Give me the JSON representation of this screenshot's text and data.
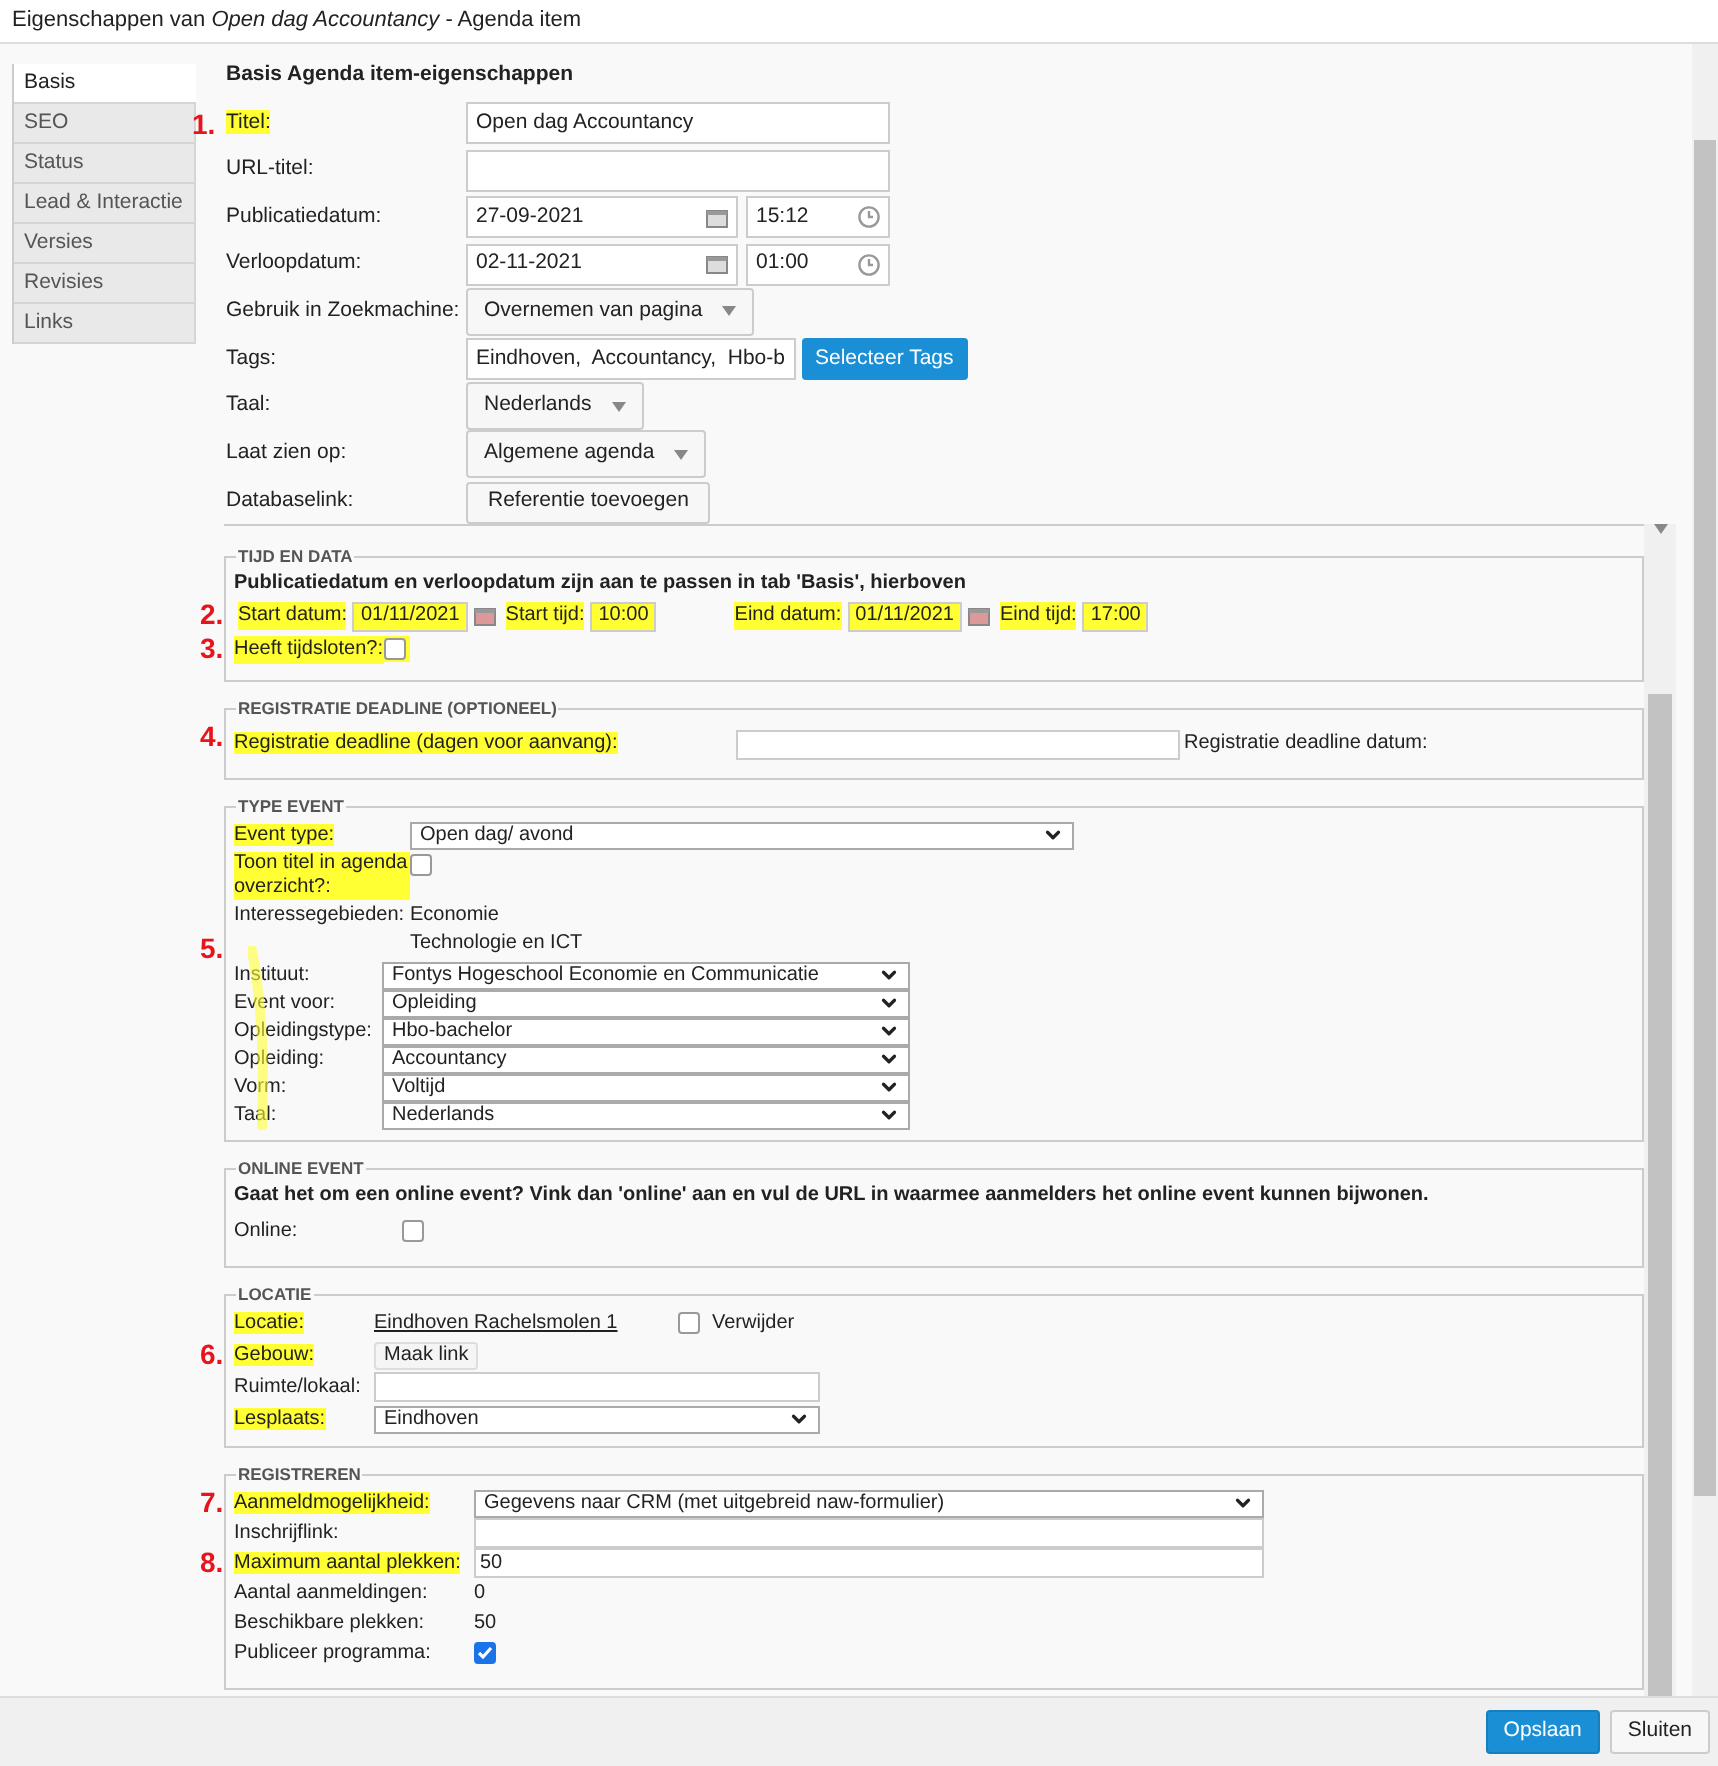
{
  "window": {
    "title": "Eigenschappen van *Open dag Accountancy* - Agenda item"
  },
  "tabs": [
    {
      "label": "Basis",
      "selected": true
    },
    {
      "label": "SEO",
      "selected": false
    },
    {
      "label": "Status",
      "selected": false
    },
    {
      "label": "Lead & Interactie",
      "selected": false
    },
    {
      "label": "Versies",
      "selected": false
    },
    {
      "label": "Revisies",
      "selected": false
    },
    {
      "label": "Links",
      "selected": false
    }
  ],
  "basis": {
    "heading": "Basis Agenda item-eigenschappen",
    "fields": [
      {
        "kind": "text",
        "label": "Titel:",
        "value": "Open dag Accountancy",
        "marker": "1.",
        "highlighted": true
      },
      {
        "kind": "text",
        "label": "URL-titel:",
        "highlighted": false
      },
      {
        "kind": "datetime",
        "label": "Publicatiedatum:",
        "date": "27-09-2021",
        "time": "15:12",
        "highlighted": false
      },
      {
        "kind": "datetime",
        "label": "Verloopdatum:",
        "date": "02-11-2021",
        "time": "01:00",
        "highlighted": false
      },
      {
        "kind": "select",
        "label": "Gebruik in Zoekmachine:",
        "value": "Overnemen van pagina",
        "highlighted": false
      },
      {
        "kind": "tags",
        "label": "Tags:",
        "value": "Eindhoven,  Accountancy,  Hbo-b",
        "button": "Selecteer Tags",
        "highlighted": false
      },
      {
        "kind": "select",
        "label": "Taal:",
        "value": "Nederlands",
        "highlighted": false
      },
      {
        "kind": "select",
        "label": "Laat zien op:",
        "value": "Algemene agenda",
        "highlighted": false
      },
      {
        "kind": "button",
        "label": "Databaselink:",
        "button": "Referentie toevoegen",
        "highlighted": false
      }
    ]
  },
  "sections": [
    {
      "legend": "TIJD EN DATA",
      "rows": [
        {
          "kind": "note",
          "text": "Publicatiedatum en verloopdatum zijn aan te passen in tab 'Basis', hierboven"
        },
        {
          "kind": "dates",
          "marker": "2.",
          "parts": [
            {
              "label": "Start datum:",
              "value": "01/11/2021",
              "calendar": true,
              "highlighted": true
            },
            {
              "label": "Start tijd:",
              "value": "10:00",
              "calendar": false,
              "highlighted": true
            },
            {
              "label": "Eind datum:",
              "value": "01/11/2021",
              "calendar": true,
              "highlighted": true
            },
            {
              "label": "Eind tijd:",
              "value": "17:00",
              "calendar": false,
              "highlighted": true
            }
          ]
        },
        {
          "kind": "checkbox-inline",
          "label": "Heeft tijdsloten?:",
          "checked": false,
          "marker": "3.",
          "highlighted": true
        }
      ]
    },
    {
      "legend": "REGISTRATIE DEADLINE (OPTIONEEL)",
      "rows": [
        {
          "kind": "deadline",
          "label": "Registratie deadline (dagen voor aanvang):",
          "after": "Registratie deadline datum:",
          "marker": "4.",
          "highlighted": true
        }
      ]
    },
    {
      "legend": "TYPE EVENT",
      "rows": [
        {
          "kind": "select",
          "label": "Event type:",
          "value": "Open dag/ avond",
          "highlighted": true
        },
        {
          "kind": "checkbox-wrap",
          "label": "Toon titel in agenda overzicht?:",
          "checked": false,
          "highlighted": true
        },
        {
          "kind": "values",
          "label": "Interessegebieden:",
          "values": [
            "Economie",
            "Technologie en ICT"
          ],
          "highlighted": false
        },
        {
          "kind": "select-group",
          "marker": "5.",
          "highlighted": true,
          "items": [
            {
              "label": "Instituut:",
              "value": "Fontys Hogeschool Economie en Communicatie"
            },
            {
              "label": "Event voor:",
              "value": "Opleiding"
            },
            {
              "label": "Opleidingstype:",
              "value": "Hbo-bachelor"
            },
            {
              "label": "Opleiding:",
              "value": "Accountancy"
            },
            {
              "label": "Vorm:",
              "value": "Voltijd"
            },
            {
              "label": "Taal:",
              "value": "Nederlands"
            }
          ]
        }
      ]
    },
    {
      "legend": "ONLINE EVENT",
      "rows": [
        {
          "kind": "note",
          "text": "Gaat het om een online event? Vink dan 'online' aan en vul de URL in waarmee aanmelders het online event kunnen bijwonen."
        },
        {
          "kind": "checkbox",
          "label": "Online:",
          "checked": false,
          "highlighted": false
        }
      ]
    },
    {
      "legend": "LOCATIE",
      "rows": [
        {
          "kind": "link",
          "label": "Locatie:",
          "value": "Eindhoven Rachelsmolen 1",
          "check_label": "Verwijder",
          "checked": false,
          "highlighted": true
        },
        {
          "kind": "button",
          "label": "Gebouw:",
          "value": "Maak link",
          "marker": "6.",
          "highlighted": true
        },
        {
          "kind": "text",
          "label": "Ruimte/lokaal:",
          "highlighted": false
        },
        {
          "kind": "select",
          "label": "Lesplaats:",
          "value": "Eindhoven",
          "highlighted": true
        }
      ]
    },
    {
      "legend": "REGISTREREN",
      "rows": [
        {
          "kind": "select",
          "label": "Aanmeldmogelijkheid:",
          "value": "Gegevens naar CRM (met uitgebreid naw-formulier)",
          "marker": "7.",
          "highlighted": true
        },
        {
          "kind": "text",
          "label": "Inschrijflink:",
          "highlighted": false
        },
        {
          "kind": "text",
          "label": "Maximum aantal plekken:",
          "value": "50",
          "marker": "8.",
          "highlighted": true
        },
        {
          "kind": "value",
          "label": "Aantal aanmeldingen:",
          "value": "0",
          "highlighted": false
        },
        {
          "kind": "value",
          "label": "Beschikbare plekken:",
          "value": "50",
          "highlighted": false
        },
        {
          "kind": "checkbox",
          "label": "Publiceer programma:",
          "checked": true,
          "highlighted": false
        }
      ]
    }
  ],
  "footer": {
    "buttons": [
      {
        "label": "Opslaan",
        "kind": "primary"
      },
      {
        "label": "Sluiten",
        "kind": "default"
      }
    ]
  }
}
